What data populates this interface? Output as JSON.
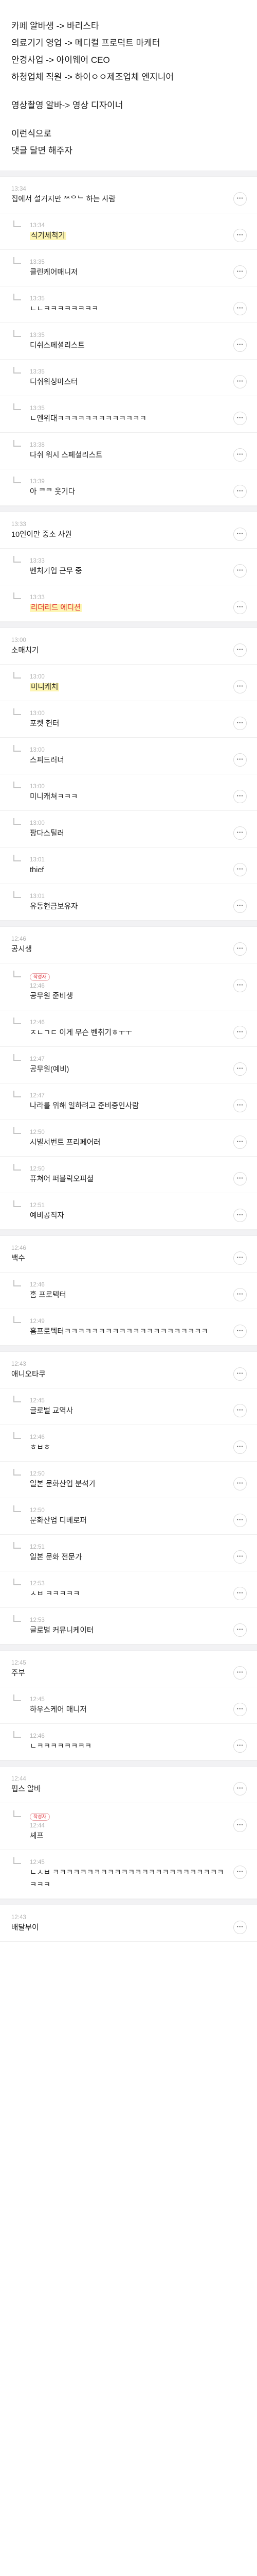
{
  "intro": {
    "lines": [
      "카페 알바생 -> 바리스타",
      "의료기기 영업 -> 메디컬 프로덕트 마케터",
      "안경사업 -> 아이웨어 CEO",
      "하청업체 직원 -> 하이ㅇㅇ제조업체 엔지니어"
    ],
    "lines2": [
      "영상촬영 알바-> 영상 디자이너"
    ],
    "lines3": [
      "이런식으로",
      "댓글 달면 해주자"
    ]
  },
  "more_label": "···",
  "author_badge": "작성자",
  "threads": [
    {
      "parent": {
        "time": "13:34",
        "text": "집에서 설거지만 ᄍᄋᄂ 하는 사람"
      },
      "replies": [
        {
          "time": "13:34",
          "text": "식기세척기",
          "highlight": true
        },
        {
          "time": "13:35",
          "text": "클린케어매니저"
        },
        {
          "time": "13:35",
          "text": "ㄴㄴㅋㅋㅋㅋㅋㅋㅋㅋ"
        },
        {
          "time": "13:35",
          "text": "디쉬스페셜리스트"
        },
        {
          "time": "13:35",
          "text": "디쉬워싱마스터"
        },
        {
          "time": "13:35",
          "text": "ㄴ엔위대ㅋㅋㅋㅋㅋㅋㅋㅋㅋㅋㅋㅋㅋ"
        },
        {
          "time": "13:38",
          "text": "다쉬 워시 스페셜리스트"
        },
        {
          "time": "13:39",
          "text": "아 ᄏᄏ 웃기다"
        }
      ]
    },
    {
      "parent": {
        "time": "13:33",
        "text": "10인이만 중소 사원"
      },
      "replies": [
        {
          "time": "13:33",
          "text": "벤처기업 근무 중"
        },
        {
          "time": "13:33",
          "text": "리더리드 에디션",
          "highlight": true,
          "red": true
        }
      ]
    },
    {
      "parent": {
        "time": "13:00",
        "text": "소매치기"
      },
      "replies": [
        {
          "time": "13:00",
          "text": "미니캐처",
          "highlight": true
        },
        {
          "time": "13:00",
          "text": "포켓 헌터"
        },
        {
          "time": "13:00",
          "text": "스피드러너"
        },
        {
          "time": "13:00",
          "text": "미니캐쳐ㅋㅋㅋ"
        },
        {
          "time": "13:00",
          "text": "팡다스틸러"
        },
        {
          "time": "13:01",
          "text": "thief"
        },
        {
          "time": "13:01",
          "text": "유동현금보유자"
        }
      ]
    },
    {
      "parent": {
        "time": "12:46",
        "text": "공시생"
      },
      "replies": [
        {
          "time": "12:46",
          "text": "공무원 준비생",
          "author": true
        },
        {
          "time": "12:46",
          "text": "ㅈㄴㄱㄷ 이게 무슨 벤취기ㅎㅜㅜ"
        },
        {
          "time": "12:47",
          "text": "공무원(예비)"
        },
        {
          "time": "12:47",
          "text": "나라를 위해 일하려고 준비중인사람"
        },
        {
          "time": "12:50",
          "text": "시빌서번트 프리페어러"
        },
        {
          "time": "12:50",
          "text": "퓨쳐어 퍼블릭오피셜"
        },
        {
          "time": "12:51",
          "text": "예비공직자"
        }
      ]
    },
    {
      "parent": {
        "time": "12:46",
        "text": "백수"
      },
      "replies": [
        {
          "time": "12:46",
          "text": "홈 프로텍터"
        },
        {
          "time": "12:49",
          "text": "홈프로텍터ㅋㅋㅋㅋㅋㅋㅋㅋㅋㅋㅋㅋㅋㅋㅋㅋㅋㅋㅋㅋㅋ"
        }
      ]
    },
    {
      "parent": {
        "time": "12:43",
        "text": "애니오타쿠"
      },
      "replies": [
        {
          "time": "12:45",
          "text": "글로벌 교역사"
        },
        {
          "time": "12:46",
          "text": "ㅎㅂㅎ"
        },
        {
          "time": "12:50",
          "text": "일본 문화산업 분석가"
        },
        {
          "time": "12:50",
          "text": "문화산업 디베로퍼"
        },
        {
          "time": "12:51",
          "text": "일본 문화 전문가"
        },
        {
          "time": "12:53",
          "text": "ㅅㅂ ㅋㅋㅋㅋㅋ"
        },
        {
          "time": "12:53",
          "text": "글로벌 커뮤니케이터"
        }
      ]
    },
    {
      "parent": {
        "time": "12:45",
        "text": "주부"
      },
      "replies": [
        {
          "time": "12:45",
          "text": "하우스케어 매니저"
        },
        {
          "time": "12:46",
          "text": "ㄴㅋㅋㅋㅋㅋㅋㅋㅋ"
        }
      ]
    },
    {
      "parent": {
        "time": "12:44",
        "text": "펍스 알바"
      },
      "replies": [
        {
          "time": "12:44",
          "text": "셰프",
          "author": true
        },
        {
          "time": "12:45",
          "text": "ㄴㅅㅂ ㅋㅋㅋㅋㅋㅋㅋㅋㅋㅋㅋㅋㅋㅋㅋㅋㅋㅋㅋㅋㅋㅋㅋㅋㅋㅋㅋㅋ"
        }
      ]
    },
    {
      "parent": {
        "time": "12:43",
        "text": "배달부이"
      },
      "replies": []
    }
  ]
}
